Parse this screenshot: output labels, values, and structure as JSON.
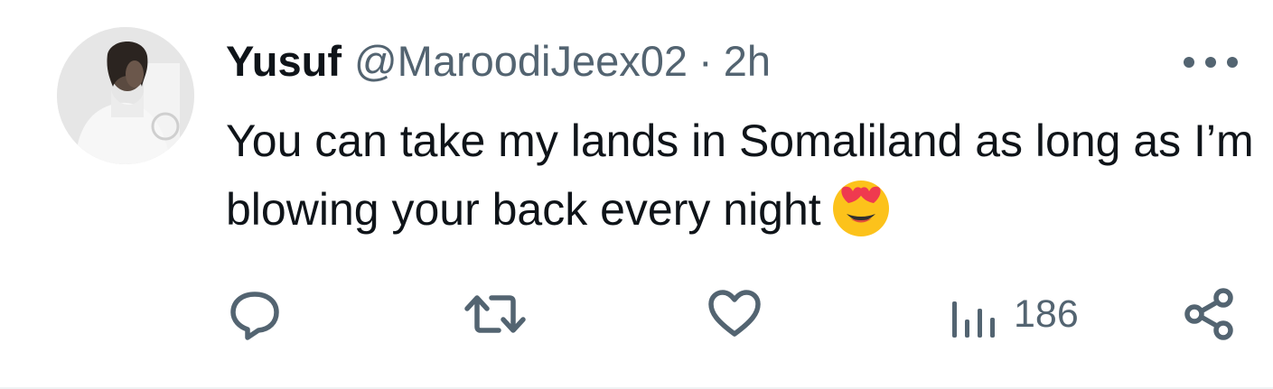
{
  "tweet": {
    "author_name": "Yusuf",
    "handle": "@MaroodiJeex02",
    "separator": "·",
    "time": "2h",
    "text": "You can take my lands in Somaliland as long as I’m blowing your back every night",
    "emoji": "smiling-face-with-heart-eyes"
  },
  "actions": {
    "views_count": "186"
  },
  "icons": {
    "reply": "reply-icon",
    "retweet": "retweet-icon",
    "like": "heart-icon",
    "views": "views-icon",
    "share": "share-icon",
    "more": "more-icon"
  },
  "colors": {
    "text_primary": "#0f1419",
    "text_secondary": "#536471",
    "divider": "#eff3f4"
  }
}
